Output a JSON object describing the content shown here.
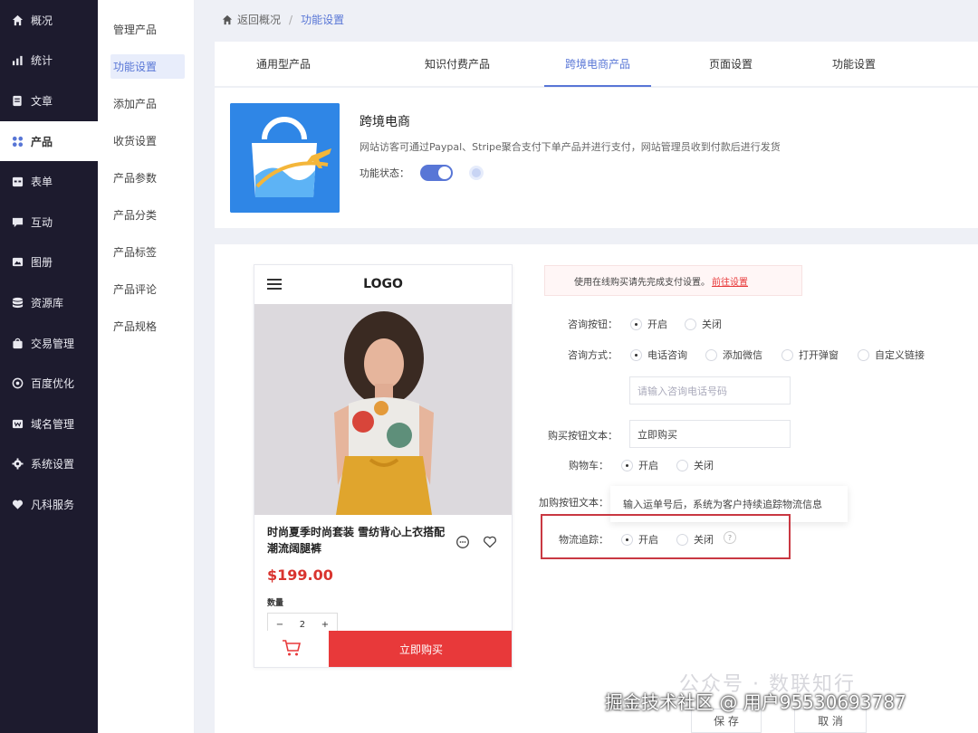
{
  "sidebar": {
    "items": [
      {
        "label": "概况",
        "icon": "home-icon"
      },
      {
        "label": "统计",
        "icon": "chart-icon"
      },
      {
        "label": "文章",
        "icon": "document-icon"
      },
      {
        "label": "产品",
        "icon": "grid-icon",
        "active": true
      },
      {
        "label": "表单",
        "icon": "calendar-icon"
      },
      {
        "label": "互动",
        "icon": "chat-icon"
      },
      {
        "label": "图册",
        "icon": "gallery-icon"
      },
      {
        "label": "资源库",
        "icon": "database-icon"
      },
      {
        "label": "交易管理",
        "icon": "bag-icon"
      },
      {
        "label": "百度优化",
        "icon": "target-icon"
      },
      {
        "label": "域名管理",
        "icon": "domain-icon"
      },
      {
        "label": "系统设置",
        "icon": "gear-icon"
      },
      {
        "label": "凡科服务",
        "icon": "heart-icon"
      }
    ]
  },
  "subnav": {
    "items": [
      {
        "label": "管理产品"
      },
      {
        "label": "功能设置",
        "active": true
      },
      {
        "label": "添加产品"
      },
      {
        "label": "收货设置"
      },
      {
        "label": "产品参数"
      },
      {
        "label": "产品分类"
      },
      {
        "label": "产品标签"
      },
      {
        "label": "产品评论"
      },
      {
        "label": "产品规格"
      }
    ]
  },
  "breadcrumb": {
    "back": "返回概况",
    "sep": "/",
    "current": "功能设置"
  },
  "tabs": [
    {
      "label": "通用型产品"
    },
    {
      "label": "知识付费产品"
    },
    {
      "label": "跨境电商产品",
      "active": true
    },
    {
      "label": "页面设置"
    },
    {
      "label": "功能设置"
    }
  ],
  "feature": {
    "title": "跨境电商",
    "desc": "网站访客可通过Paypal、Stripe聚合支付下单产品并进行支付，网站管理员收到付款后进行发货",
    "status_label": "功能状态：",
    "enabled": true
  },
  "phone": {
    "logo": "LOGO",
    "product_name": "时尚夏季时尚套装 雪纺背心上衣搭配潮流阔腿裤",
    "price": "$199.00",
    "qty_label": "数量",
    "minus": "−",
    "qty": "2",
    "plus": "+",
    "buy": "立即购买"
  },
  "notice": {
    "text": "使用在线购买请先完成支付设置。",
    "link": "前往设置"
  },
  "form": {
    "consult_btn": {
      "label": "咨询按钮：",
      "on": "开启",
      "off": "关闭"
    },
    "consult_way": {
      "label": "咨询方式：",
      "opt1": "电话咨询",
      "opt2": "添加微信",
      "opt3": "打开弹窗",
      "opt4": "自定义链接"
    },
    "phone_placeholder": "请输入咨询电话号码",
    "buy_text": {
      "label": "购买按钮文本：",
      "value": "立即购买"
    },
    "cart": {
      "label": "购物车：",
      "on": "开启",
      "off": "关闭"
    },
    "addcart_label": "加购按钮文本：",
    "tooltip": "输入运单号后，系统为客户持续追踪物流信息",
    "tracking": {
      "label": "物流追踪：",
      "on": "开启",
      "off": "关闭",
      "help": "?"
    }
  },
  "buttons": {
    "save": "保 存",
    "cancel": "取 消"
  },
  "watermarks": {
    "wechat": "公众号 · 数联知行",
    "site": "掘金技术社区 @ 用户9553069378​7"
  },
  "colors": {
    "accent": "#5876d6",
    "sidebar_bg": "#1d1b2e",
    "buy_red": "#e8393a",
    "highlight": "#c93842"
  }
}
